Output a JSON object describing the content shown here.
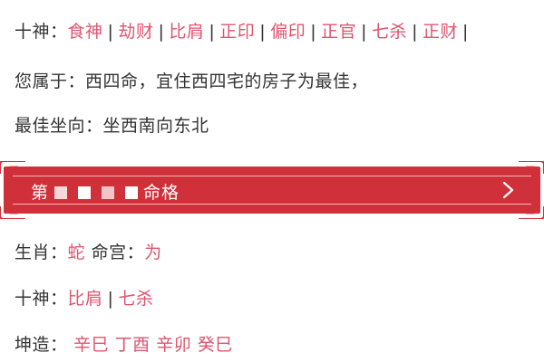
{
  "shishen_line": {
    "label": "十神：",
    "items": [
      "食神",
      "劫财",
      "比肩",
      "正印",
      "偏印",
      "正官",
      "七杀",
      "正财"
    ]
  },
  "belongs_line": {
    "text": "您属于：西四命，宜住西四宅的房子为最佳，"
  },
  "direction_line": {
    "text": "最佳坐向：坐西南向东北"
  },
  "banner": {
    "prefix": "第",
    "suffix": "命格"
  },
  "zodiac_line": {
    "shengxiao_label": "生肖：",
    "shengxiao_value": "蛇",
    "minggong_label": "命宫：",
    "minggong_value": "为"
  },
  "shishen2_line": {
    "label": "十神：",
    "items": [
      "比肩",
      "七杀"
    ]
  },
  "kunzao_line": {
    "label": "坤造：",
    "pillars": [
      "辛巳",
      "丁酉",
      "辛卯",
      "癸巳"
    ]
  },
  "colors": {
    "accent_pink": "#e0546f",
    "banner_red": "#d0303a",
    "text": "#333333"
  },
  "icons": {
    "banner_chevron": "chevron-right-icon"
  }
}
